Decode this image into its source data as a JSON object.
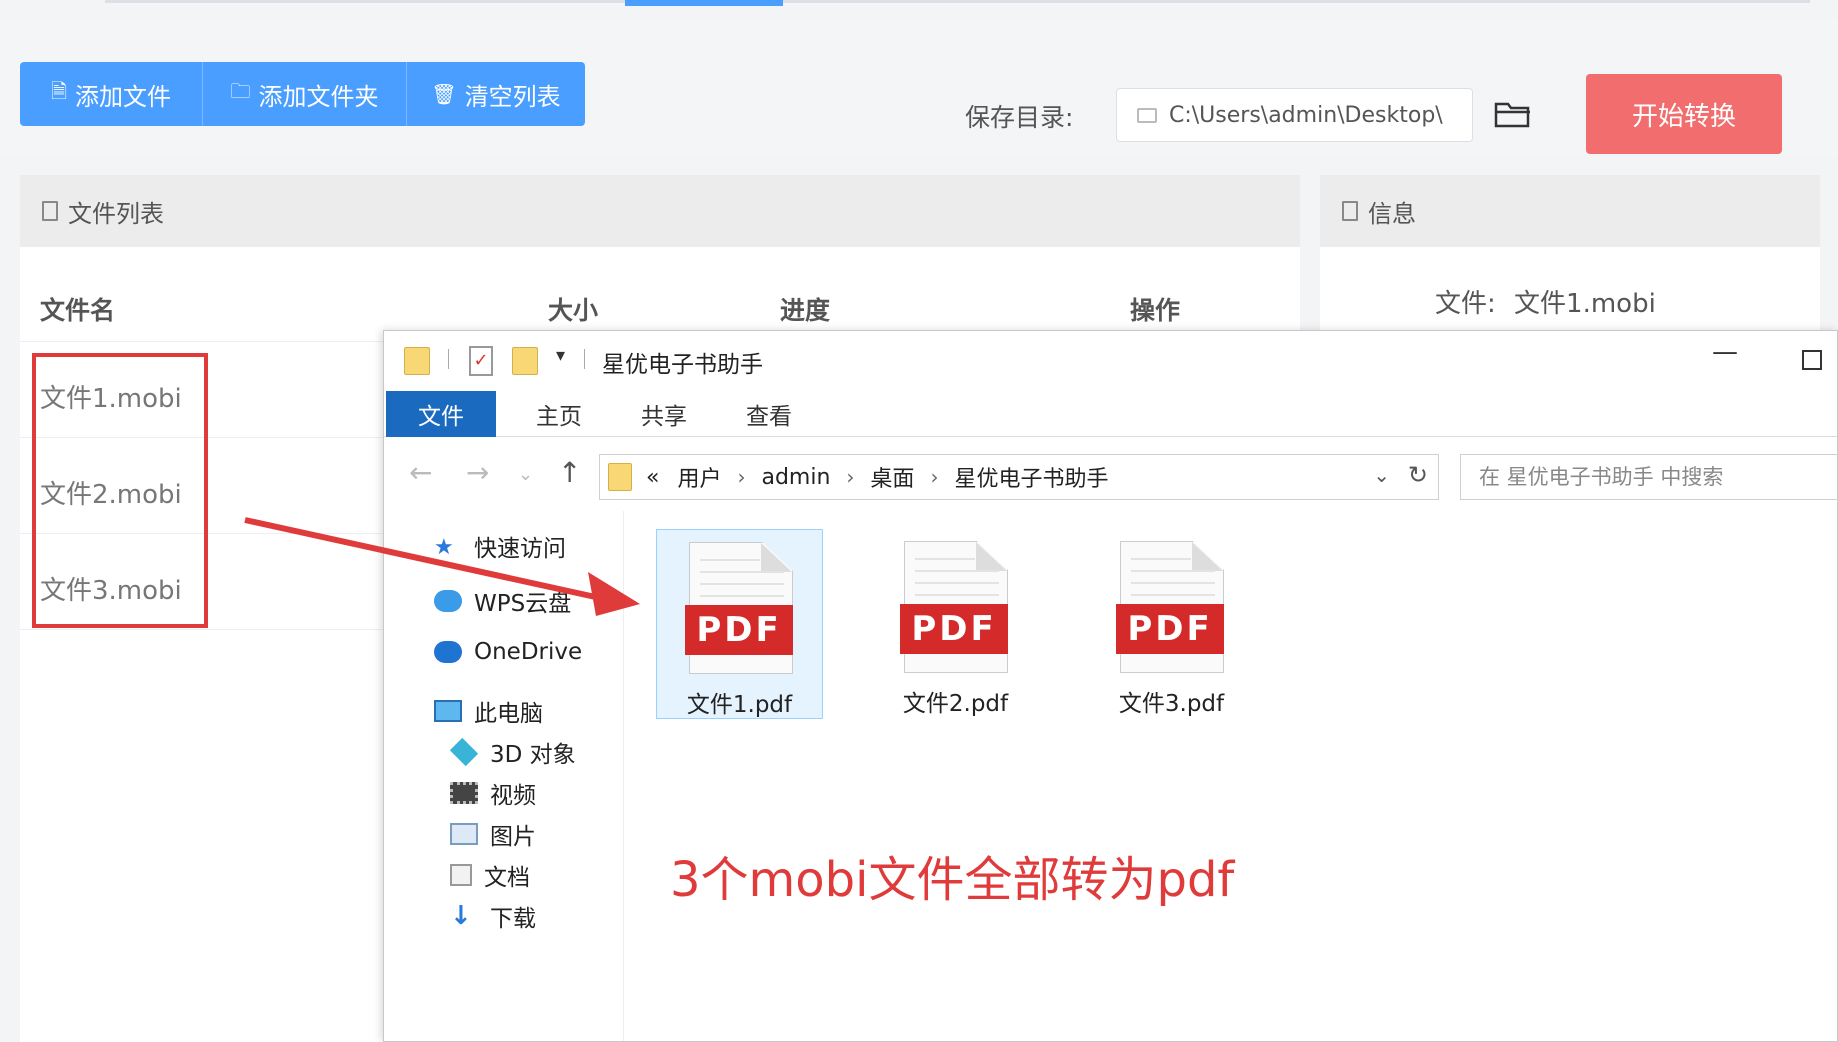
{
  "toolbar": {
    "add_file": "添加文件",
    "add_folder": "添加文件夹",
    "clear_list": "清空列表",
    "save_dir_label": "保存目录:",
    "save_dir_value": "C:\\Users\\admin\\Desktop\\",
    "start_button": "开始转换"
  },
  "file_list": {
    "title": "文件列表",
    "columns": [
      "文件名",
      "大小",
      "进度",
      "操作"
    ],
    "rows": [
      {
        "name": "文件1.mobi"
      },
      {
        "name": "文件2.mobi"
      },
      {
        "name": "文件3.mobi"
      }
    ]
  },
  "info": {
    "title": "信息",
    "file_label": "文件:",
    "file_value": "文件1.mobi"
  },
  "explorer": {
    "title": "星优电子书助手",
    "ribbon_tabs": [
      "文件",
      "主页",
      "共享",
      "查看"
    ],
    "breadcrumb": [
      "用户",
      "admin",
      "桌面",
      "星优电子书助手"
    ],
    "breadcrumb_prefix": "«",
    "search_placeholder": "在 星优电子书助手 中搜索",
    "nav_items": [
      "快速访问",
      "WPS云盘",
      "OneDrive",
      "此电脑",
      "3D 对象",
      "视频",
      "图片",
      "文档",
      "下载"
    ],
    "files": [
      {
        "badge": "PDF",
        "name": "文件1.pdf"
      },
      {
        "badge": "PDF",
        "name": "文件2.pdf"
      },
      {
        "badge": "PDF",
        "name": "文件3.pdf"
      }
    ]
  },
  "annotation": "3个mobi文件全部转为pdf",
  "colors": {
    "primary": "#4a9eff",
    "start_button": "#f26d6d",
    "highlight_red": "#e03b3b",
    "ribbon_active": "#1a6bbf",
    "pdf_red": "#d42a2a"
  }
}
